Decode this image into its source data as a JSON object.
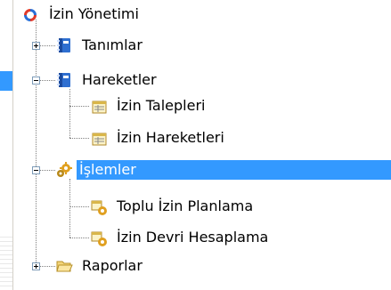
{
  "tree": {
    "root": {
      "label": "İzin Yönetimi",
      "icon": "app-refresh-icon"
    },
    "items": [
      {
        "label": "Tanımlar",
        "icon": "book-icon",
        "expander": "plus"
      },
      {
        "label": "Hareketler",
        "icon": "book-icon",
        "expander": "minus",
        "children": [
          {
            "label": "İzin Talepleri",
            "icon": "form-icon"
          },
          {
            "label": "İzin Hareketleri",
            "icon": "form-icon"
          }
        ]
      },
      {
        "label": "İşlemler",
        "icon": "gears-icon",
        "expander": "minus",
        "selected": true,
        "children": [
          {
            "label": "Toplu İzin Planlama",
            "icon": "process-icon"
          },
          {
            "label": "İzin Devri Hesaplama",
            "icon": "process-icon"
          }
        ]
      },
      {
        "label": "Raporlar",
        "icon": "folder-icon",
        "expander": "plus"
      }
    ]
  },
  "colors": {
    "selection": "#3399ff",
    "connector": "#808080",
    "expander_border": "#7f9db9"
  }
}
